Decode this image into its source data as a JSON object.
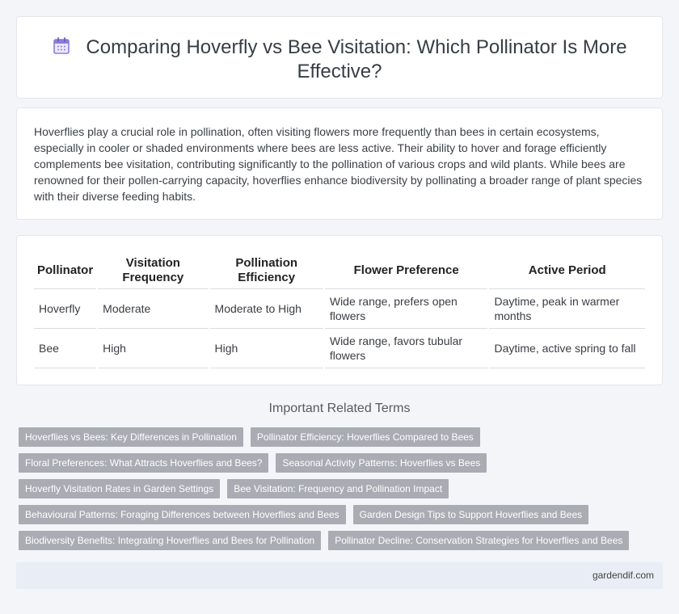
{
  "header": {
    "title": "Comparing Hoverfly vs Bee Visitation: Which Pollinator Is More Effective?",
    "icon": "calendar-icon"
  },
  "intro": {
    "text": "Hoverflies play a crucial role in pollination, often visiting flowers more frequently than bees in certain ecosystems, especially in cooler or shaded environments where bees are less active. Their ability to hover and forage efficiently complements bee visitation, contributing significantly to the pollination of various crops and wild plants. While bees are renowned for their pollen-carrying capacity, hoverflies enhance biodiversity by pollinating a broader range of plant species with their diverse feeding habits."
  },
  "table": {
    "headers": [
      "Pollinator",
      "Visitation Frequency",
      "Pollination Efficiency",
      "Flower Preference",
      "Active Period"
    ],
    "rows": [
      [
        "Hoverfly",
        "Moderate",
        "Moderate to High",
        "Wide range, prefers open flowers",
        "Daytime, peak in warmer months"
      ],
      [
        "Bee",
        "High",
        "High",
        "Wide range, favors tubular flowers",
        "Daytime, active spring to fall"
      ]
    ]
  },
  "terms": {
    "heading": "Important Related Terms",
    "rows": [
      [
        "Hoverflies vs Bees: Key Differences in Pollination",
        "Pollinator Efficiency: Hoverflies Compared to Bees"
      ],
      [
        "Floral Preferences: What Attracts Hoverflies and Bees?",
        "Seasonal Activity Patterns: Hoverflies vs Bees"
      ],
      [
        "Hoverfly Visitation Rates in Garden Settings",
        "Bee Visitation: Frequency and Pollination Impact"
      ],
      [
        "Behavioural Patterns: Foraging Differences between Hoverflies and Bees",
        "Garden Design Tips to Support Hoverflies and Bees"
      ],
      [
        "Biodiversity Benefits: Integrating Hoverflies and Bees for Pollination",
        "Pollinator Decline: Conservation Strategies for Hoverflies and Bees"
      ]
    ]
  },
  "footer": {
    "site": "gardendif.com"
  },
  "colors": {
    "tag_bg": "#a9acb3",
    "footer_bg": "#e8edf6",
    "icon_purple": "#8b7ed8"
  }
}
